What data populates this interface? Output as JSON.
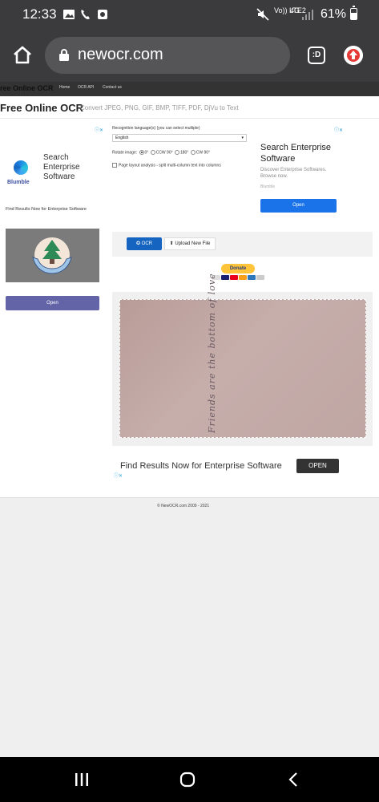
{
  "status_bar": {
    "time": "12:33",
    "signal_label": "Vo)) LTE2",
    "network": "4G",
    "battery": "61%",
    "battery_level": 0.61
  },
  "browser": {
    "url": "newocr.com",
    "tab_label": ":D"
  },
  "site_nav": {
    "brand": "ree Online OCR",
    "links": [
      "Home",
      "OCR API",
      "Contact us"
    ]
  },
  "header": {
    "title": "Free Online OCR",
    "subtitle": "Convert JPEG, PNG, GIF, BMP, TIFF, PDF, DjVu to Text"
  },
  "ad_left": {
    "brand": "Blumble",
    "title": "Search Enterprise Software",
    "find_text": "Find Results Now for Enterprise Software",
    "open_label": "Open"
  },
  "form": {
    "lang_label": "Recognition language(s) (you can select multiple)",
    "lang_value": "English",
    "rotate_label": "Rotate image:",
    "rotate_options": [
      "0°",
      "CCW 90°",
      "180°",
      "CW 90°"
    ],
    "layout_label": "Page layout analysis - split multi-column text into columns"
  },
  "ad_right": {
    "title": "Search Enterprise Software",
    "desc": "Discover Enterprise Softwares. Browse now.",
    "brand": "Blumble",
    "open_label": "Open"
  },
  "tools": {
    "ocr_label": "✪ OCR",
    "upload_label": "⬆ Upload New File",
    "donate_label": "Donate"
  },
  "preview": {
    "handwriting": "Friends are the bottom of love"
  },
  "ad_bottom": {
    "text": "Find Results Now for Enterprise Software",
    "open_label": "OPEN"
  },
  "footer": {
    "copyright": "© NewOCR.com 2009 - 2021"
  },
  "colors": {
    "accent": "#1565c0",
    "ad_button": "#6264a7",
    "donate": "#ffc439",
    "chrome": "#3b3b3d"
  }
}
